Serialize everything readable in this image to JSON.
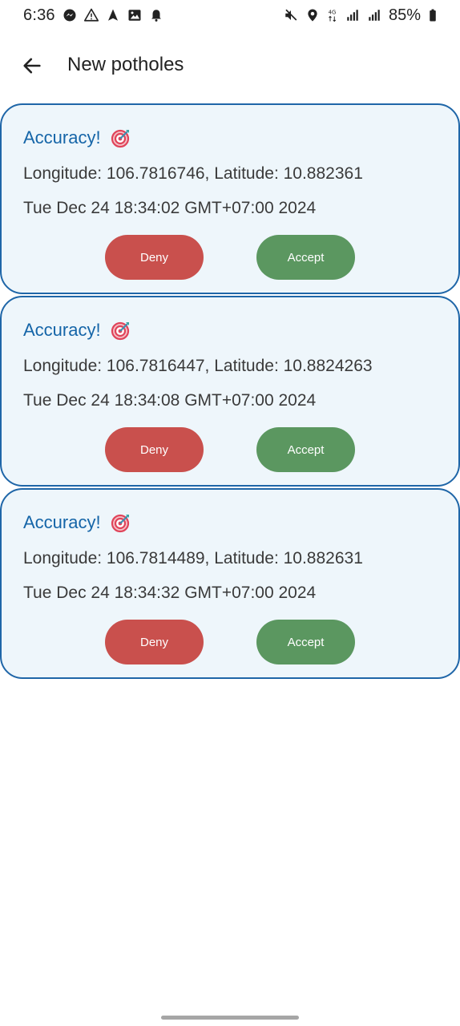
{
  "status_bar": {
    "time": "6:36",
    "left_icons": [
      "messenger-icon",
      "warning-icon",
      "navigation-icon",
      "gallery-icon",
      "notification-bell-icon"
    ],
    "right_icons": [
      "mute-icon",
      "location-icon",
      "network-4g-icon",
      "signal-icon",
      "signal-icon"
    ],
    "network_label": "4G",
    "battery_percent": "85%"
  },
  "app_bar": {
    "back_icon": "arrow-left-icon",
    "title": "New potholes"
  },
  "colors": {
    "card_border": "#1f66a8",
    "card_background": "#eef6fb",
    "title_blue": "#1565a8",
    "deny_red": "#c9504d",
    "accept_green": "#5b9760"
  },
  "cards": [
    {
      "title": "Accuracy!",
      "icon": "target-icon",
      "coordinates": "Longitude: 106.7816746, Latitude: 10.882361",
      "timestamp": "Tue Dec 24 18:34:02 GMT+07:00 2024",
      "deny_label": "Deny",
      "accept_label": "Accept"
    },
    {
      "title": "Accuracy!",
      "icon": "target-icon",
      "coordinates": "Longitude: 106.7816447, Latitude: 10.8824263",
      "timestamp": "Tue Dec 24 18:34:08 GMT+07:00 2024",
      "deny_label": "Deny",
      "accept_label": "Accept"
    },
    {
      "title": "Accuracy!",
      "icon": "target-icon",
      "coordinates": "Longitude: 106.7814489, Latitude: 10.882631",
      "timestamp": "Tue Dec 24 18:34:32 GMT+07:00 2024",
      "deny_label": "Deny",
      "accept_label": "Accept"
    }
  ]
}
